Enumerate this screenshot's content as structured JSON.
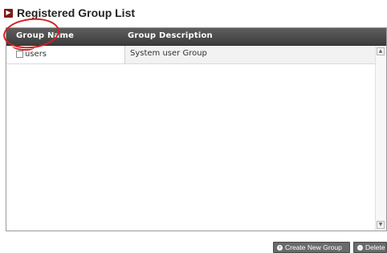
{
  "page": {
    "title": "Registered Group List",
    "title_icon": "arrow-right-square-icon"
  },
  "table": {
    "columns": [
      "Group Name",
      "Group Description"
    ],
    "rows": [
      {
        "name": "users",
        "description": "System user Group",
        "checked": false
      }
    ]
  },
  "annotation": {
    "type": "red hand-drawn circle",
    "color": "#d42020",
    "target": "users"
  },
  "buttons": {
    "create": {
      "label": "Create New Group",
      "icon": "plus-icon"
    },
    "delete": {
      "label": "Delete",
      "icon": "minus-icon"
    }
  },
  "colors": {
    "header_bg": "#4a4a4a",
    "title_mark": "#7a1c14",
    "button_bg": "#6a6a6a"
  }
}
